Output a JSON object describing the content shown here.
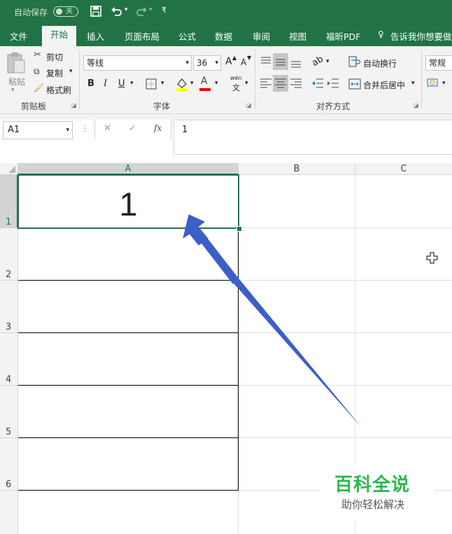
{
  "titlebar": {
    "autosave_label": "自动保存",
    "autosave_state": "关",
    "icons": [
      "save-icon",
      "undo-icon",
      "redo-icon",
      "customize-icon"
    ]
  },
  "tabs": [
    {
      "label": "文件"
    },
    {
      "label": "开始"
    },
    {
      "label": "插入"
    },
    {
      "label": "页面布局"
    },
    {
      "label": "公式"
    },
    {
      "label": "数据"
    },
    {
      "label": "审阅"
    },
    {
      "label": "视图"
    },
    {
      "label": "福昕PDF"
    },
    {
      "label": "告诉我你想要做什"
    }
  ],
  "active_tab": "开始",
  "ribbon": {
    "clipboard": {
      "paste": "粘贴",
      "cut": "剪切",
      "copy": "复制",
      "format_painter": "格式刷",
      "group_label": "剪贴板"
    },
    "font": {
      "font_name": "等线",
      "font_size": "36",
      "bold": "B",
      "italic": "I",
      "underline": "U",
      "phonetic": "wén",
      "phonetic_char": "文",
      "grow": "A",
      "shrink": "A",
      "font_color_letter": "A",
      "group_label": "字体"
    },
    "alignment": {
      "wrap_text": "自动换行",
      "merge_center": "合并后居中",
      "group_label": "对齐方式"
    },
    "number": {
      "format": "常规"
    }
  },
  "formula_bar": {
    "name_box": "A1",
    "cancel": "✕",
    "enter": "✓",
    "fx": "fx",
    "content": "1"
  },
  "sheet": {
    "columns": [
      "A",
      "B",
      "C"
    ],
    "rows": [
      "1",
      "2",
      "3",
      "4",
      "5",
      "6"
    ],
    "cells": {
      "A1": "1"
    },
    "selected": "A1"
  },
  "watermark": {
    "title": "百科全说",
    "subtitle": "助你轻松解决"
  },
  "colors": {
    "accent": "#217346",
    "arrow": "#3c5fc7",
    "watermark": "#2db84d"
  }
}
